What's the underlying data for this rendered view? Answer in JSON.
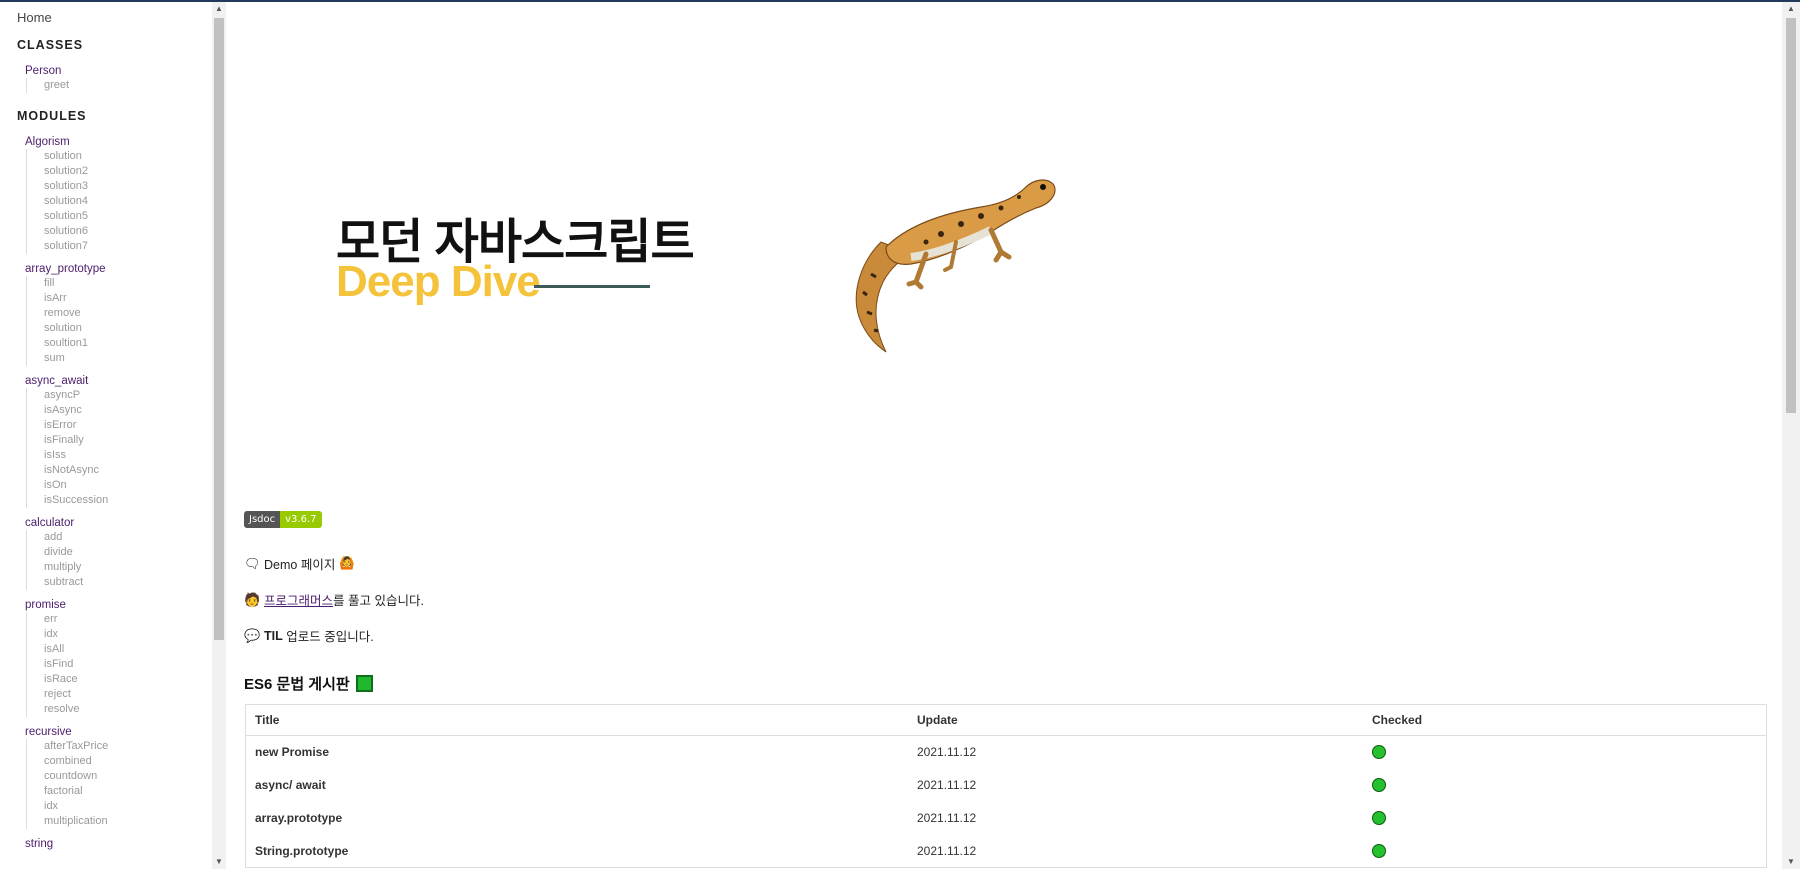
{
  "sidebar": {
    "home": "Home",
    "classes_heading": "CLASSES",
    "classes": [
      {
        "name": "Person",
        "items": [
          "greet"
        ]
      }
    ],
    "modules_heading": "MODULES",
    "modules": [
      {
        "name": "Algorism",
        "items": [
          "solution",
          "solution2",
          "solution3",
          "solution4",
          "solution5",
          "solution6",
          "solution7"
        ]
      },
      {
        "name": "array_prototype",
        "items": [
          "fill",
          "isArr",
          "remove",
          "solution",
          "soultion1",
          "sum"
        ]
      },
      {
        "name": "async_await",
        "items": [
          "asyncP",
          "isAsync",
          "isError",
          "isFinally",
          "isIss",
          "isNotAsync",
          "isOn",
          "isSuccession"
        ]
      },
      {
        "name": "calculator",
        "items": [
          "add",
          "divide",
          "multiply",
          "subtract"
        ]
      },
      {
        "name": "promise",
        "items": [
          "err",
          "idx",
          "isAll",
          "isFind",
          "isRace",
          "reject",
          "resolve"
        ]
      },
      {
        "name": "recursive",
        "items": [
          "afterTaxPrice",
          "combined",
          "countdown",
          "factorial",
          "idx",
          "multiplication"
        ]
      },
      {
        "name": "string",
        "items": []
      }
    ]
  },
  "hero": {
    "title_ko": "모던 자바스크립트",
    "title_en": "Deep Dive",
    "image_icon": "gecko-illustration"
  },
  "badge": {
    "label": "Jsdoc",
    "version": "v3.6.7"
  },
  "lines": {
    "demo_text": "Demo 페이지",
    "demo_icon": "speech-bubble-icon",
    "demo_emoji": "🙆",
    "prog_link": "프로그래머스",
    "prog_rest": "를 풀고 있습니다.",
    "prog_icon": "person-icon",
    "til_bold": "TIL",
    "til_rest": " 업로드 중입니다.",
    "til_icon": "chat-icon"
  },
  "section": {
    "title": "ES6 문법 게시판"
  },
  "table": {
    "headers": [
      "Title",
      "Update",
      "Checked"
    ],
    "rows": [
      {
        "title": "new Promise",
        "update": "2021.11.12"
      },
      {
        "title": "async/ await",
        "update": "2021.11.12"
      },
      {
        "title": "array.prototype",
        "update": "2021.11.12"
      },
      {
        "title": "String.prototype",
        "update": "2021.11.12"
      }
    ]
  },
  "colors": {
    "accent": "#4b1e6b",
    "deep_dive_yellow": "#f5c33b",
    "checked_green": "#25c02e",
    "badge_green": "#97ca00"
  }
}
